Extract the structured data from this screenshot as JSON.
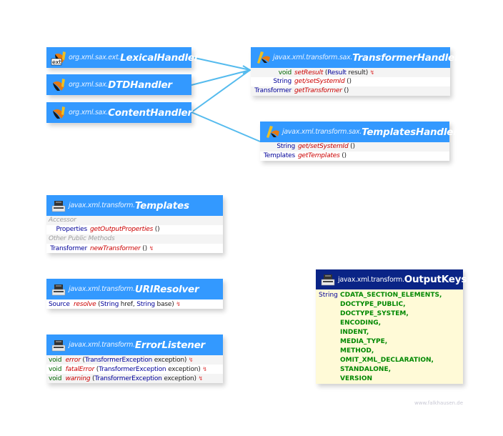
{
  "colors": {
    "interface_header": "#3399ff",
    "class_header": "#0a2486",
    "connector": "#55bbee",
    "constant_bg": "#fffad7"
  },
  "sax_interfaces": [
    {
      "package": "org.xml.sax.ext.",
      "name": "LexicalHandler",
      "icon": "ext-interface-icon"
    },
    {
      "package": "org.xml.sax.",
      "name": "DTDHandler",
      "icon": "interface-icon"
    },
    {
      "package": "org.xml.sax.",
      "name": "ContentHandler",
      "icon": "interface-icon"
    }
  ],
  "transformer_handler": {
    "package": "javax.xml.transform.sax.",
    "name": "TransformerHandler",
    "members": [
      {
        "type": "void",
        "method": "setResult",
        "params": "(Result result)",
        "params_parts": [
          {
            "t": "Result",
            "c": "blue"
          },
          {
            "t": " result)",
            "c": "plain"
          }
        ],
        "throws": true
      },
      {
        "type": "String",
        "method": "get/setSystemId",
        "params": "()",
        "throws": false
      },
      {
        "type": "Transformer",
        "method": "getTransformer",
        "params": "()",
        "throws": false
      }
    ]
  },
  "templates_handler": {
    "package": "javax.xml.transform.sax.",
    "name": "TemplatesHandler",
    "members": [
      {
        "type": "String",
        "method": "get/setSystemId",
        "params": "()"
      },
      {
        "type": "Templates",
        "method": "getTemplates",
        "params": "()"
      }
    ]
  },
  "templates": {
    "package": "javax.xml.transform.",
    "name": "Templates",
    "sections": [
      {
        "label": "Accessor",
        "members": [
          {
            "type": "Properties",
            "method": "getOutputProperties",
            "params": "()"
          }
        ]
      },
      {
        "label": "Other Public Methods",
        "members": [
          {
            "type": "Transformer",
            "method": "newTransformer",
            "params": "()",
            "throws": true
          }
        ]
      }
    ]
  },
  "uri_resolver": {
    "package": "javax.xml.transform.",
    "name": "URIResolver",
    "members": [
      {
        "type": "Source",
        "method": "resolve",
        "p1type": "String",
        "p1": " href, ",
        "p2type": "String",
        "p2": " base)",
        "throws": true
      }
    ]
  },
  "error_listener": {
    "package": "javax.xml.transform.",
    "name": "ErrorListener",
    "members": [
      {
        "type": "void",
        "method": "error",
        "ptype": "TransformerException",
        "pname": " exception)",
        "throws": true
      },
      {
        "type": "void",
        "method": "fatalError",
        "ptype": "TransformerException",
        "pname": " exception)",
        "throws": true
      },
      {
        "type": "void",
        "method": "warning",
        "ptype": "TransformerException",
        "pname": " exception)",
        "throws": true
      }
    ]
  },
  "output_keys": {
    "package": "javax.xml.transform.",
    "name": "OutputKeys",
    "type": "String",
    "constants": [
      "CDATA_SECTION_ELEMENTS,",
      "DOCTYPE_PUBLIC,",
      "DOCTYPE_SYSTEM,",
      "ENCODING,",
      "INDENT,",
      "MEDIA_TYPE,",
      "METHOD,",
      "OMIT_XML_DECLARATION,",
      "STANDALONE,",
      "VERSION"
    ]
  },
  "watermark": "www.falkhausen.de",
  "symbols": {
    "throws": "↯",
    "open_paren": " (",
    "empty_parens": " ()"
  }
}
